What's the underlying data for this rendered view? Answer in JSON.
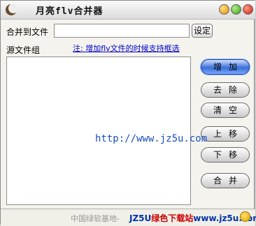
{
  "window": {
    "title": "月亮flv合并器"
  },
  "output": {
    "label": "合并到文件",
    "value": "",
    "browse_label": "设定"
  },
  "source": {
    "label": "源文件组",
    "note": "注: 增加flv文件的时候支持框选"
  },
  "buttons": {
    "add": "增加",
    "remove": "去除",
    "clear": "清空",
    "up": "上移",
    "down": "下移",
    "merge": "合并"
  },
  "watermark": "http://www.jz5u.com",
  "status": {
    "text": "中国绿软基地-",
    "banner_a": "JZ5U",
    "banner_b": "绿色下载站",
    "banner_c": "www.jz5u.com"
  }
}
